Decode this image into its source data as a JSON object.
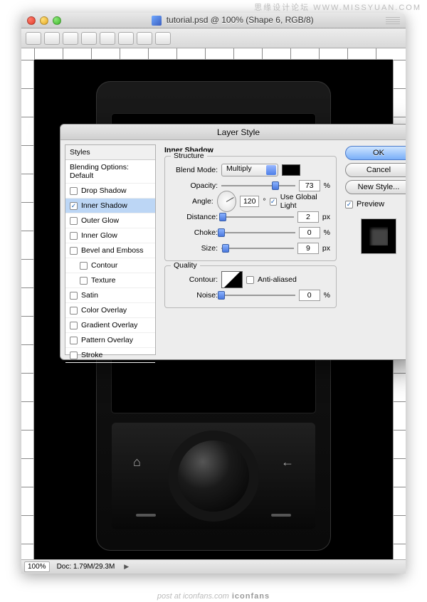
{
  "watermark_top": "思缘设计论坛 WWW.MISSYUAN.COM",
  "footer": {
    "pre": "post at ",
    "site": "iconfans.com",
    "brand": " iconfans"
  },
  "window": {
    "title": "tutorial.psd @ 100% (Shape 6, RGB/8)"
  },
  "statusbar": {
    "zoom": "100%",
    "doc": "Doc: 1.79M/29.3M"
  },
  "dialog": {
    "title": "Layer Style",
    "styles_header": "Styles",
    "blending_options": "Blending Options: Default",
    "effects": [
      {
        "label": "Drop Shadow",
        "checked": false,
        "active": false,
        "indent": false
      },
      {
        "label": "Inner Shadow",
        "checked": true,
        "active": true,
        "indent": false
      },
      {
        "label": "Outer Glow",
        "checked": false,
        "active": false,
        "indent": false
      },
      {
        "label": "Inner Glow",
        "checked": false,
        "active": false,
        "indent": false
      },
      {
        "label": "Bevel and Emboss",
        "checked": false,
        "active": false,
        "indent": false
      },
      {
        "label": "Contour",
        "checked": false,
        "active": false,
        "indent": true
      },
      {
        "label": "Texture",
        "checked": false,
        "active": false,
        "indent": true
      },
      {
        "label": "Satin",
        "checked": false,
        "active": false,
        "indent": false
      },
      {
        "label": "Color Overlay",
        "checked": false,
        "active": false,
        "indent": false
      },
      {
        "label": "Gradient Overlay",
        "checked": false,
        "active": false,
        "indent": false
      },
      {
        "label": "Pattern Overlay",
        "checked": false,
        "active": false,
        "indent": false
      },
      {
        "label": "Stroke",
        "checked": false,
        "active": false,
        "indent": false
      }
    ],
    "panel_heading": "Inner Shadow",
    "structure_legend": "Structure",
    "quality_legend": "Quality",
    "labels": {
      "blend_mode": "Blend Mode:",
      "opacity": "Opacity:",
      "angle": "Angle:",
      "use_global": "Use Global Light",
      "distance": "Distance:",
      "choke": "Choke:",
      "size": "Size:",
      "contour": "Contour:",
      "anti_alias": "Anti-aliased",
      "noise": "Noise:"
    },
    "values": {
      "blend_mode": "Multiply",
      "color": "#000000",
      "opacity": "73",
      "opacity_pct": 73,
      "angle": "120",
      "angle_deg": 120,
      "use_global": true,
      "distance": "2",
      "choke": "0",
      "size": "9",
      "anti_aliased": false,
      "noise": "0"
    },
    "units": {
      "pct": "%",
      "deg": "°",
      "px": "px"
    },
    "buttons": {
      "ok": "OK",
      "cancel": "Cancel",
      "new_style": "New Style...",
      "preview": "Preview"
    },
    "preview_checked": true
  }
}
